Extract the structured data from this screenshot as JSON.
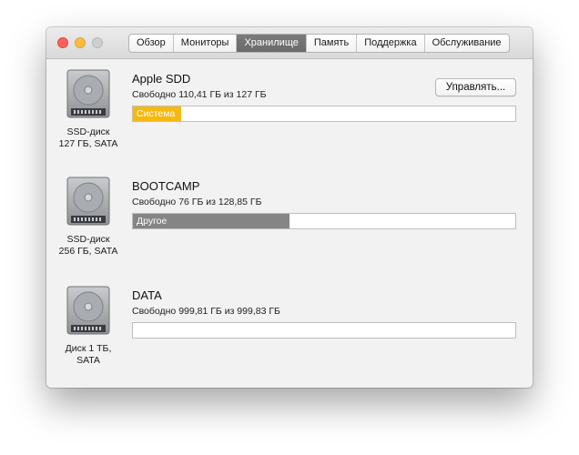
{
  "tabs": [
    {
      "label": "Обзор",
      "active": false
    },
    {
      "label": "Мониторы",
      "active": false
    },
    {
      "label": "Хранилище",
      "active": true
    },
    {
      "label": "Память",
      "active": false
    },
    {
      "label": "Поддержка",
      "active": false
    },
    {
      "label": "Обслуживание",
      "active": false
    }
  ],
  "disks": [
    {
      "name": "Apple SDD",
      "free": "Свободно 110,41 ГБ из 127 ГБ",
      "caption_line1": "SSD-диск",
      "caption_line2": "127 ГБ, SATA",
      "manage_label": "Управлять...",
      "usage": {
        "label": "Система",
        "fraction": 0.125,
        "color": "#f7b910"
      }
    },
    {
      "name": "BOOTCAMP",
      "free": "Свободно 76 ГБ из 128,85 ГБ",
      "caption_line1": "SSD-диск",
      "caption_line2": "256 ГБ, SATA",
      "usage": {
        "label": "Другое",
        "fraction": 0.41,
        "color": "#858585"
      }
    },
    {
      "name": "DATA",
      "free": "Свободно 999,81 ГБ из 999,83 ГБ",
      "caption_line1": "Диск 1 ТБ,",
      "caption_line2": "SATA",
      "usage": {
        "label": "",
        "fraction": 0,
        "color": "#858585"
      }
    }
  ]
}
